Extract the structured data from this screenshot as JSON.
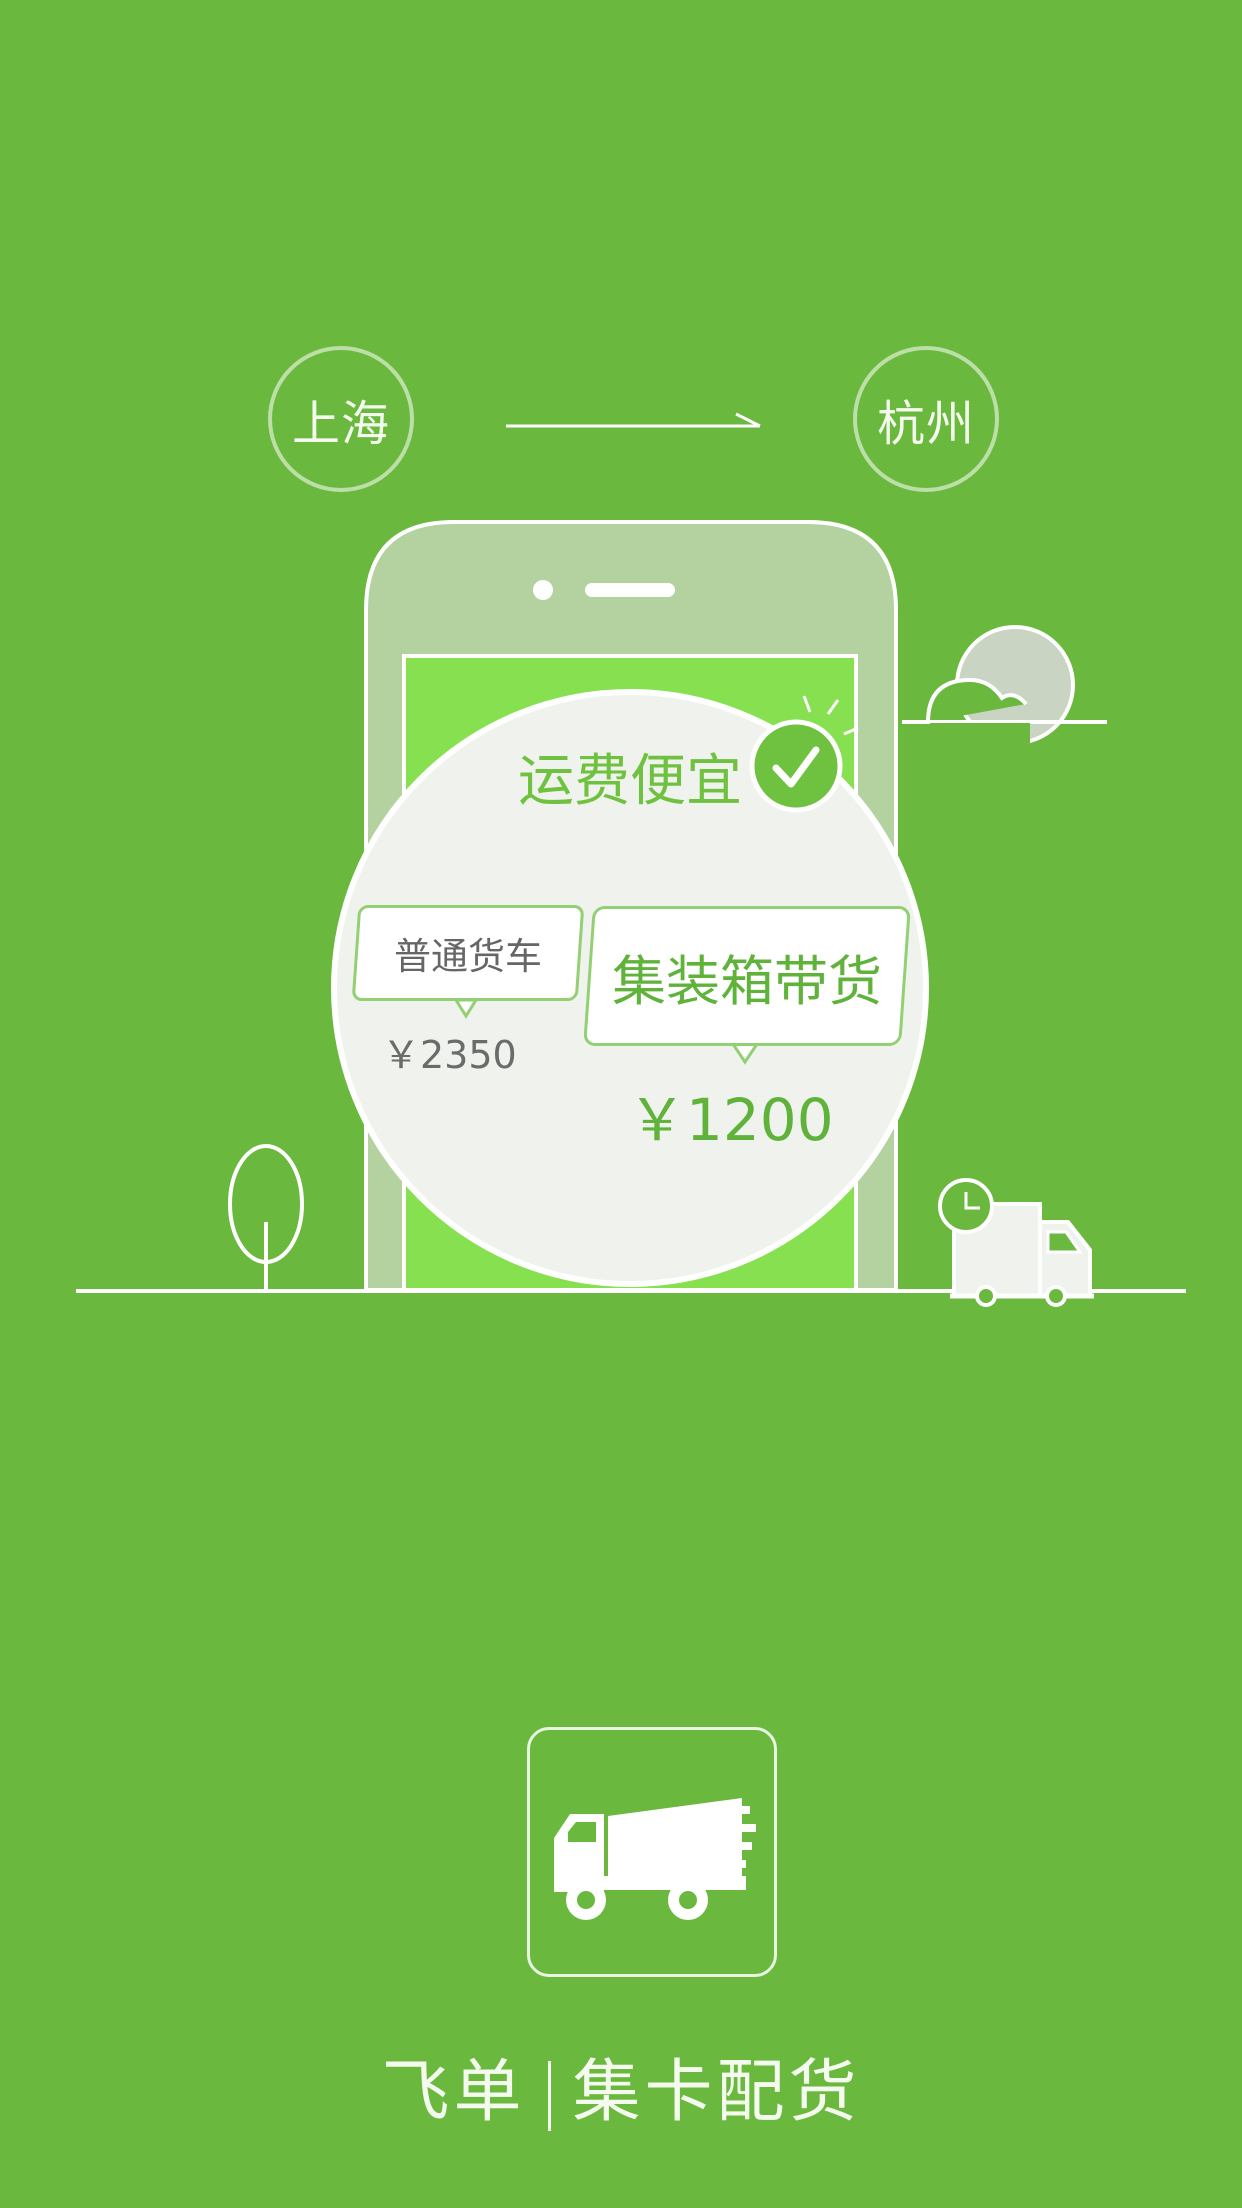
{
  "route": {
    "from": "上海",
    "to": "杭州"
  },
  "highlight": {
    "headline": "运费便宜"
  },
  "compare": {
    "left_label": "普通货车",
    "left_price": "￥2350",
    "right_label": "集装箱带货",
    "right_price": "￥1200"
  },
  "footer": {
    "brand": "飞单",
    "slogan": "集卡配货"
  },
  "colors": {
    "background": "#6ab93e",
    "accent_green": "#6fc23f",
    "phone_screen": "#86e04f"
  },
  "icons": {
    "check": "check-icon",
    "truck": "truck-icon",
    "clock": "clock-icon",
    "app_truck": "app-truck-icon"
  }
}
